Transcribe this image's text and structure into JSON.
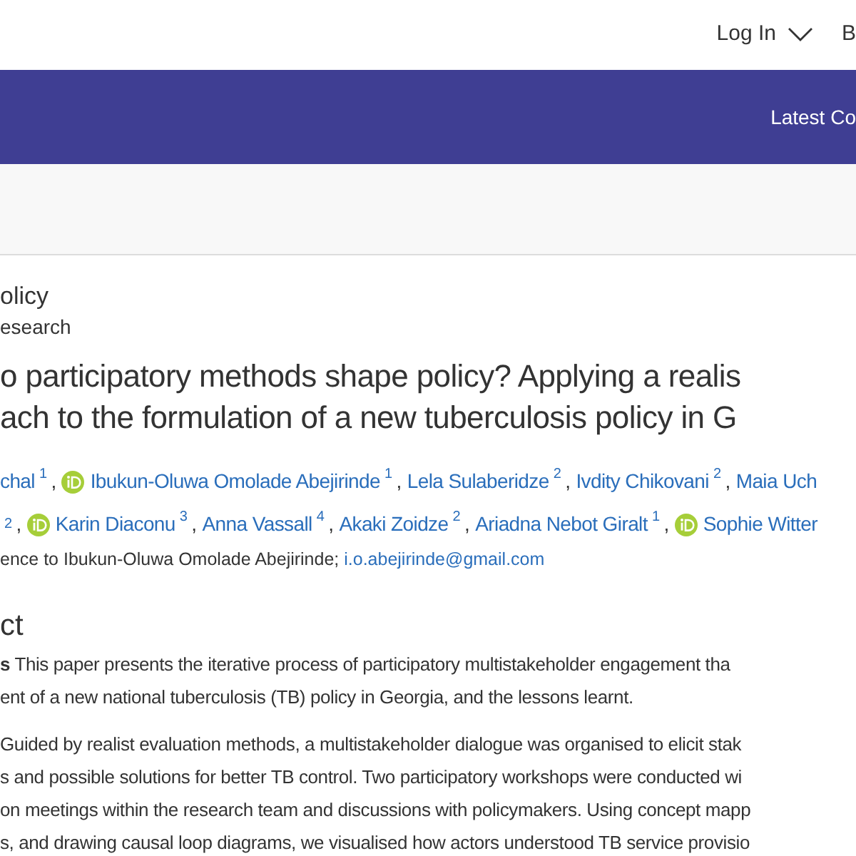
{
  "header": {
    "login": "Log In",
    "next_link": "B"
  },
  "nav_bar": {
    "link": "Latest Co"
  },
  "journal": {
    "name": "olicy",
    "section": "esearch"
  },
  "title_lines": [
    "o participatory methods shape policy? Applying a realis",
    "ach to the formulation of a new tuberculosis policy in G"
  ],
  "author_lines": [
    [
      {
        "name": "chal",
        "sup": "1",
        "orcid": false
      },
      {
        "lead": ",",
        "name": "Ibukun-Oluwa Omolade Abejirinde",
        "sup": "1",
        "orcid": true
      },
      {
        "lead": ",",
        "name": "Lela Sulaberidze",
        "sup": "2",
        "orcid": false
      },
      {
        "lead": ",",
        "name": "Ivdity Chikovani",
        "sup": "2",
        "orcid": false
      },
      {
        "lead": ",",
        "name": "Maia Uch",
        "orcid": false
      }
    ],
    [
      {
        "sup": "2",
        "orcid": false
      },
      {
        "lead": ",",
        "name": "Karin Diaconu",
        "sup": "3",
        "orcid": true
      },
      {
        "lead": ",",
        "name": "Anna Vassall",
        "sup": "4",
        "orcid": false
      },
      {
        "lead": ",",
        "name": "Akaki Zoidze",
        "sup": "2",
        "orcid": false
      },
      {
        "lead": ",",
        "name": "Ariadna Nebot Giralt",
        "sup": "1",
        "orcid": false
      },
      {
        "lead": ",",
        "name": "Sophie Witter",
        "orcid": true
      }
    ]
  ],
  "correspondence": {
    "text": "ence to Ibukun-Oluwa Omolade Abejirinde;",
    "email": "i.o.abejirinde@gmail.com"
  },
  "abstract": {
    "heading": "ct",
    "paragraphs": [
      [
        "**s** This paper presents the iterative process of participatory multistakeholder engagement tha",
        "ent of a new national tuberculosis (TB) policy in Georgia, and the lessons learnt."
      ],
      [
        "Guided by realist evaluation methods, a multistakeholder dialogue was organised to elicit stak",
        "s and possible solutions for better TB control. Two participatory workshops were conducted wi",
        "on meetings within the research team and discussions with policymakers. Using concept mapp",
        "s, and drawing causal loop diagrams, we visualised how actors understood TB service provisio"
      ]
    ]
  }
}
